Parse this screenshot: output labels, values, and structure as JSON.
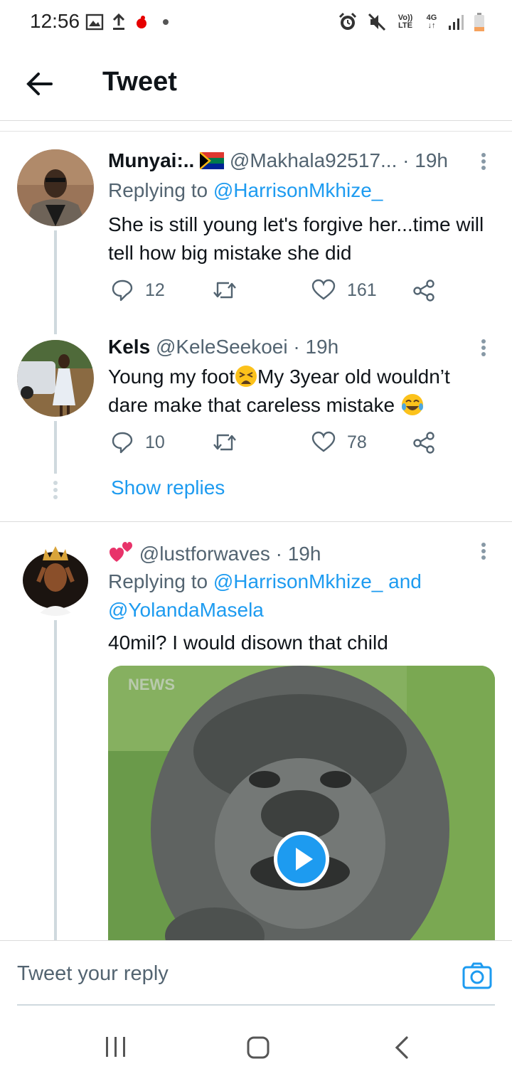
{
  "status_bar": {
    "time": "12:56",
    "network": "4G",
    "volte_top": "Vo))",
    "volte_bottom": "LTE"
  },
  "header": {
    "title": "Tweet"
  },
  "tweets": [
    {
      "name": "Munyai:..",
      "handle": "@Makhala92517...",
      "time": "· 19h",
      "reply_prefix": "Replying to",
      "reply_to": "@HarrisonMkhize_",
      "text": "She is still young let's forgive her...time will tell how big mistake she did",
      "replies": "12",
      "likes": "161"
    },
    {
      "name": "Kels",
      "handle": "@KeleSeekoei",
      "time": "· 19h",
      "text_1": "Young my foot",
      "text_2": "My 3year old wouldn’t dare make that careless mistake",
      "replies": "10",
      "likes": "78",
      "show_replies": "Show replies"
    },
    {
      "handle": "@lustforwaves",
      "time": "· 19h",
      "reply_prefix": "Replying to",
      "reply_to": "@HarrisonMkhize_",
      "reply_and": "and",
      "reply_to_2": "@YolandaMasela",
      "text": "40mil? I would disown that child",
      "media_watermark": "NEWS"
    }
  ],
  "reply_bar": {
    "placeholder": "Tweet your reply"
  },
  "colors": {
    "accent": "#1d9bf0",
    "secondary_text": "#536471",
    "thread_line": "#cfd9de"
  }
}
